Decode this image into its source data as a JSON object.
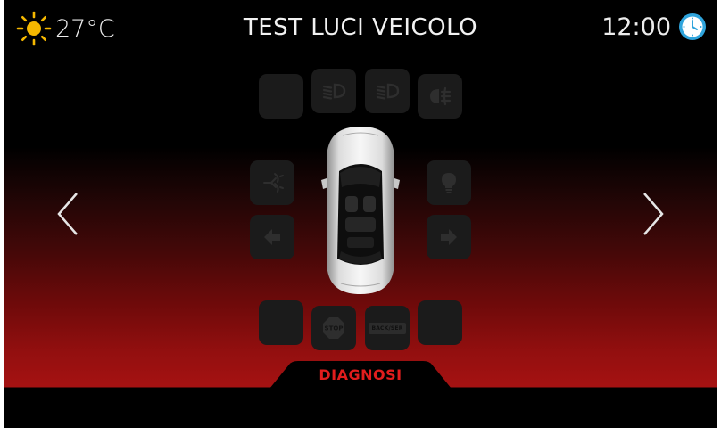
{
  "header": {
    "temperature": "27°C",
    "title": "TEST LUCI VEICOLO",
    "time": "12:00",
    "weather_icon": "sun-icon",
    "clock_icon": "clock-icon"
  },
  "navigation": {
    "previous_icon": "chevron-left-icon",
    "next_icon": "chevron-right-icon"
  },
  "lights": {
    "top_row": [
      "blank",
      "low-beam-icon",
      "low-beam-icon",
      "fog-light-icon"
    ],
    "side_left": [
      "wiper-washer-icon",
      "left-indicator-icon"
    ],
    "side_right": [
      "bulb-icon",
      "right-indicator-icon"
    ],
    "bottom_row": [
      "blank",
      "stop-light-icon",
      "reverse-light-icon",
      "blank"
    ],
    "stop_text": "STOP",
    "reverse_text": "BACK/SER"
  },
  "footer": {
    "tab_label": "DIAGNOSI"
  },
  "colors": {
    "accent": "#e11d1d",
    "sun": "#f5b800",
    "clock": "#2fa4dc",
    "tile": "#1b1b1b",
    "tile_icon": "#2e2e2e"
  }
}
